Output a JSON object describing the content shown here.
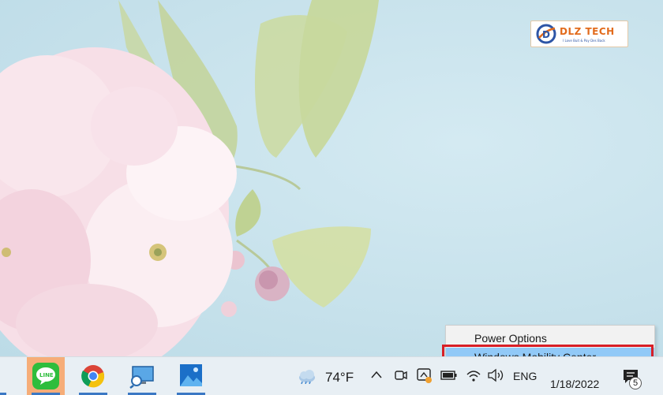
{
  "desktop": {
    "logo": {
      "brand": "DLZ TECH",
      "tagline": "I Love Buit & Pay Des Back"
    }
  },
  "context_menu": {
    "items": [
      {
        "label": "Power Options"
      },
      {
        "label": "Windows Mobility Center",
        "highlighted": true
      }
    ],
    "highlight_color": "#91c9f7",
    "annotation_color": "#d81f26"
  },
  "taskbar": {
    "apps": [
      {
        "name": "LINE",
        "icon": "line-icon",
        "active": true
      },
      {
        "name": "Google Chrome",
        "icon": "chrome-icon"
      },
      {
        "name": "Remote Desktop",
        "icon": "remote-desktop-icon"
      },
      {
        "name": "Photos",
        "icon": "photos-icon"
      }
    ],
    "weather": {
      "temp": "74°F",
      "icon": "weather-cloud-icon"
    },
    "tray": {
      "language": "ENG",
      "date": "1/18/2022",
      "notification_count": "5",
      "icons": [
        "chevron-up-icon",
        "meet-now-icon",
        "app-tray-icon",
        "battery-icon",
        "wifi-icon",
        "volume-icon"
      ]
    }
  }
}
